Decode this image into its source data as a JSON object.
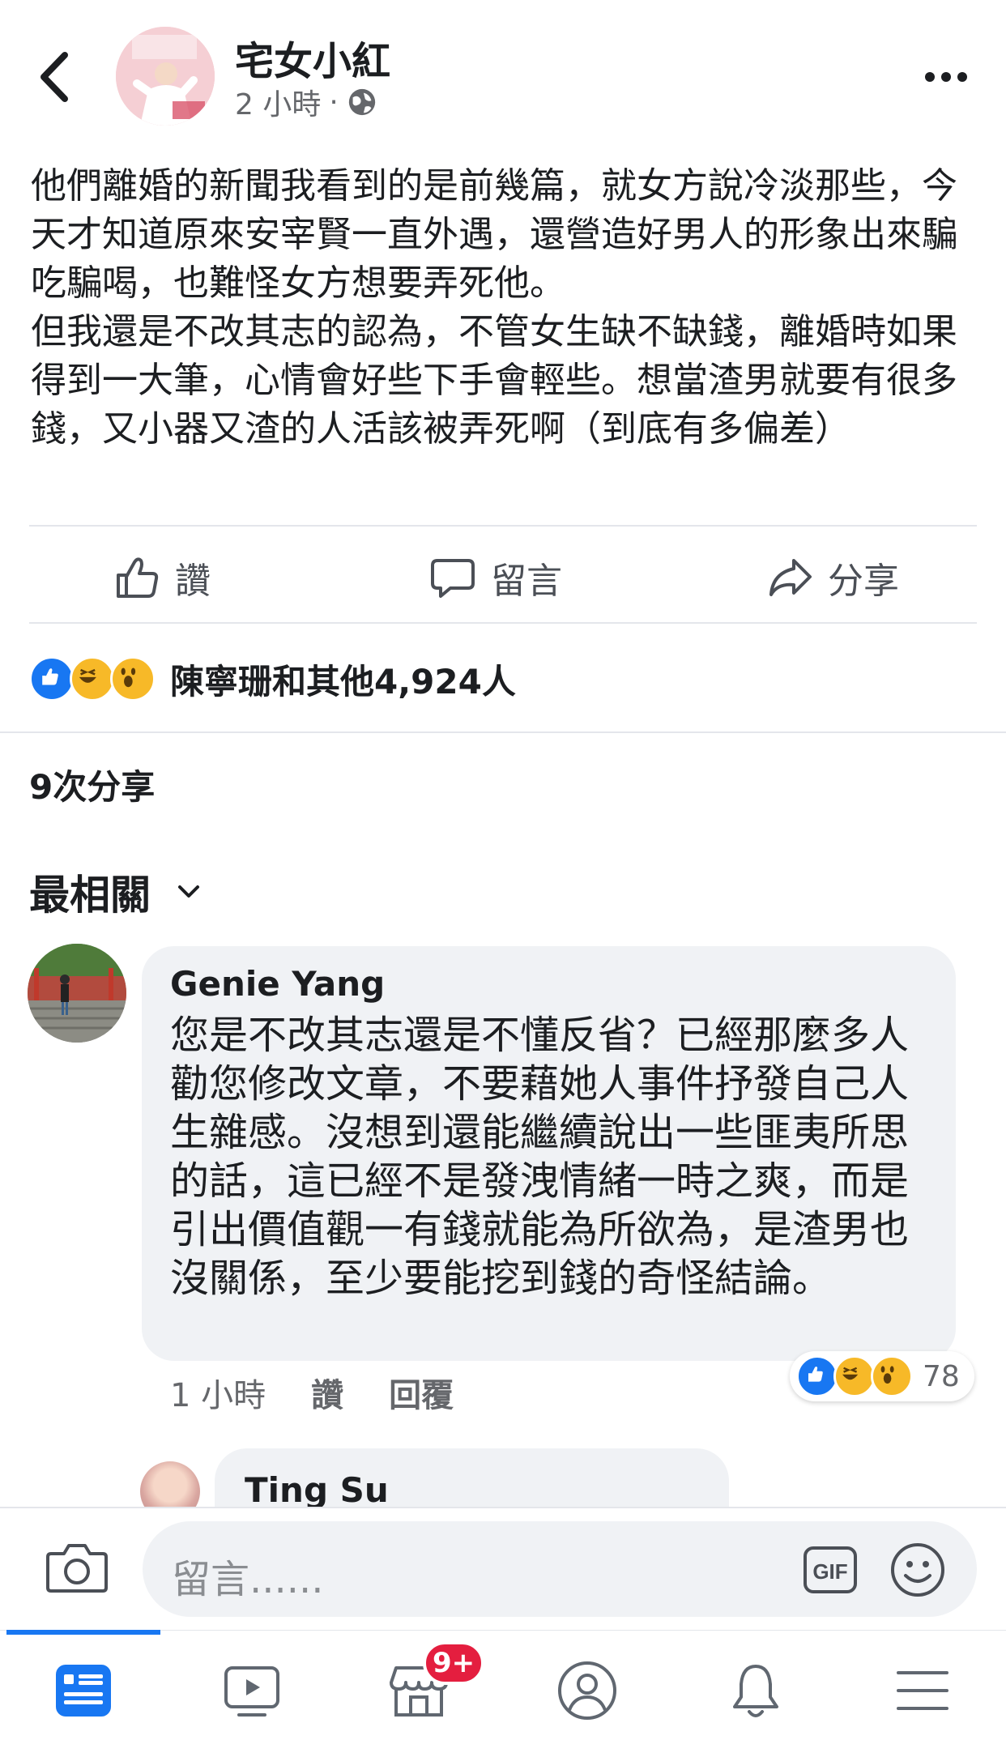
{
  "post": {
    "author": "宅女小紅",
    "time": "2 小時",
    "separator": "·",
    "text": "他們離婚的新聞我看到的是前幾篇，就女方說冷淡那些，今天才知道原來安宰賢一直外遇，還營造好男人的形象出來騙吃騙喝，也難怪女方想要弄死他。\n但我還是不改其志的認為，不管女生缺不缺錢，離婚時如果得到一大筆，心情會好些下手會輕些。想當渣男就要有很多錢，又小器又渣的人活該被弄死啊（到底有多偏差）"
  },
  "actions": {
    "like": "讚",
    "comment": "留言",
    "share": "分享"
  },
  "reactions": {
    "summary": "陳寧珊和其他4,924人",
    "types": [
      "like",
      "haha",
      "wow"
    ]
  },
  "shares": "9次分享",
  "sort": {
    "label": "最相關"
  },
  "comments": [
    {
      "author": "Genie Yang",
      "text": "您是不改其志還是不懂反省？已經那麼多人勸您修改文章，不要藉她人事件抒發自己人生雜感。沒想到還能繼續說出一些匪夷所思的話，這已經不是發洩情緒一時之爽，而是引出價值觀一有錢就能為所欲為，是渣男也沒關係，至少要能挖到錢的奇怪結論。",
      "time": "1 小時",
      "like_label": "讚",
      "reply_label": "回覆",
      "reaction_count": "78"
    },
    {
      "author": "Ting Su"
    }
  ],
  "composer": {
    "placeholder": "留言......",
    "gif_label": "GIF"
  },
  "nav": {
    "badge": "9+",
    "items": [
      "news-feed",
      "watch",
      "marketplace",
      "profile",
      "notifications",
      "menu"
    ]
  },
  "colors": {
    "accent": "#1877f2",
    "badge": "#e41e3f",
    "bubble": "#f0f2f5",
    "secondary_text": "#65676b"
  }
}
